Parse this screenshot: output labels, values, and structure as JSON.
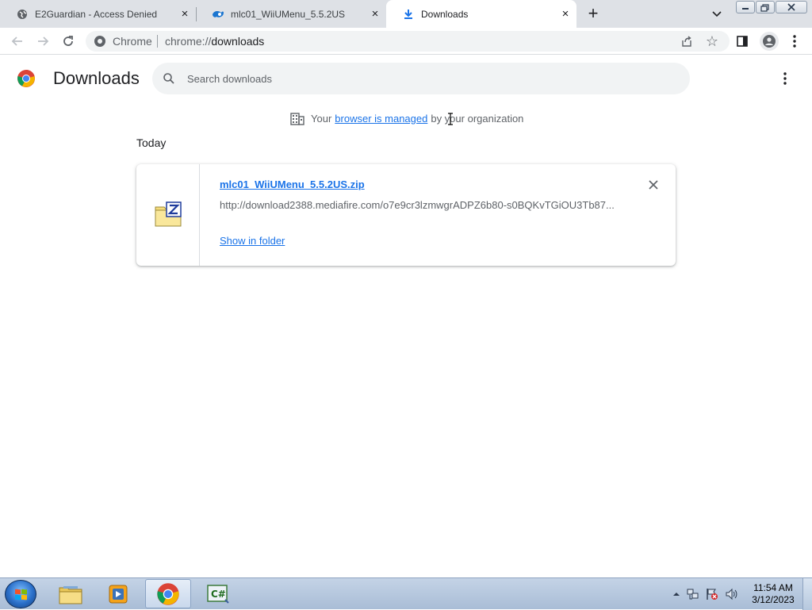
{
  "tabs": [
    {
      "label": "E2Guardian - Access Denied",
      "icon": "globe-icon",
      "close": "×"
    },
    {
      "label": "mlc01_WiiUMenu_5.5.2US",
      "icon": "mediafire-icon",
      "close": "×"
    },
    {
      "label": "Downloads",
      "icon": "download-icon",
      "close": "×"
    }
  ],
  "toolbar": {
    "new_tab": "+",
    "omnibox_chip": "Chrome",
    "url_scheme": "chrome://",
    "url_path": "downloads",
    "star": "☆"
  },
  "page": {
    "title": "Downloads",
    "search_placeholder": "Search downloads",
    "managed": {
      "prefix": "Your",
      "link": "browser is managed",
      "suffix": "by your organization"
    },
    "section": "Today"
  },
  "download": {
    "file_name": "mlc01_WiiUMenu_5.5.2US.zip",
    "url": "http://download2388.mediafire.com/o7e9cr3lzmwgrADPZ6b80-s0BQKvTGiOU3Tb87...",
    "action": "Show in folder"
  },
  "taskbar": {
    "clock_time": "11:54 AM",
    "clock_date": "3/12/2023",
    "items": [
      "explorer-icon",
      "media-player-icon",
      "chrome-icon",
      "csharp-icon"
    ]
  },
  "colors": {
    "accent": "#1a73e8",
    "tabstrip": "#dee1e6",
    "omnibox": "#f1f3f4"
  }
}
